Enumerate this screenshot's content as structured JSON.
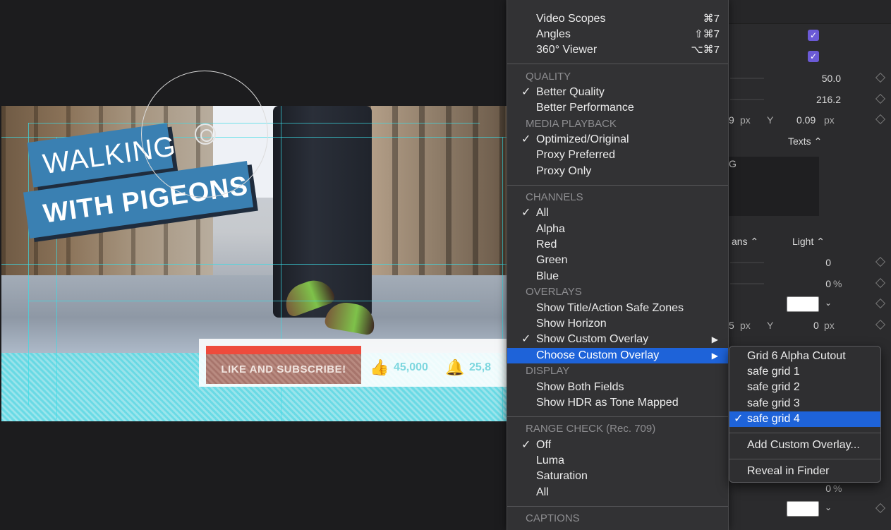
{
  "viewer": {
    "title_line1": "WALKING",
    "title_line2": "WITH PIGEONS",
    "subscribe_text": "LIKE AND SUBSCRIBE!",
    "likes_count": "45,000",
    "notify_count": "25,8"
  },
  "menu": {
    "items_top": [
      {
        "label": "Video Scopes",
        "shortcut": "⌘7"
      },
      {
        "label": "Angles",
        "shortcut": "⇧⌘7"
      },
      {
        "label": "360° Viewer",
        "shortcut": "⌥⌘7"
      }
    ],
    "quality_header": "QUALITY",
    "quality_items": [
      {
        "label": "Better Quality",
        "check": "✓"
      },
      {
        "label": "Better Performance",
        "check": ""
      }
    ],
    "media_header": "MEDIA PLAYBACK",
    "media_items": [
      {
        "label": "Optimized/Original",
        "check": "✓"
      },
      {
        "label": "Proxy Preferred",
        "check": ""
      },
      {
        "label": "Proxy Only",
        "check": ""
      }
    ],
    "channels_header": "CHANNELS",
    "channels_items": [
      {
        "label": "All",
        "check": "✓"
      },
      {
        "label": "Alpha",
        "check": ""
      },
      {
        "label": "Red",
        "check": ""
      },
      {
        "label": "Green",
        "check": ""
      },
      {
        "label": "Blue",
        "check": ""
      }
    ],
    "overlays_header": "OVERLAYS",
    "overlays_items": [
      {
        "label": "Show Title/Action Safe Zones",
        "check": ""
      },
      {
        "label": "Show Horizon",
        "check": ""
      },
      {
        "label": "Show Custom Overlay",
        "check": "✓",
        "arrow": "▶"
      },
      {
        "label": "Choose Custom Overlay",
        "check": "",
        "arrow": "▶"
      }
    ],
    "display_header": "DISPLAY",
    "display_items": [
      {
        "label": "Show Both Fields",
        "check": ""
      },
      {
        "label": "Show HDR as Tone Mapped",
        "check": ""
      }
    ],
    "range_header": "RANGE CHECK (Rec. 709)",
    "range_items": [
      {
        "label": "Off",
        "check": "✓"
      },
      {
        "label": "Luma",
        "check": ""
      },
      {
        "label": "Saturation",
        "check": ""
      },
      {
        "label": "All",
        "check": ""
      }
    ],
    "captions_header": "CAPTIONS"
  },
  "submenu": {
    "items": [
      {
        "label": "Grid 6 Alpha Cutout",
        "check": ""
      },
      {
        "label": "safe grid 1",
        "check": ""
      },
      {
        "label": "safe grid 2",
        "check": ""
      },
      {
        "label": "safe grid 3",
        "check": ""
      },
      {
        "label": "safe grid 4",
        "check": "✓"
      }
    ],
    "add_overlay": "Add Custom Overlay...",
    "reveal_finder": "Reveal in Finder"
  },
  "inspector": {
    "v_50": "50.0",
    "v_216": "216.2",
    "px_unit": "px",
    "pos_x_frag": "9",
    "y_label": "Y",
    "pos_y": "0.09",
    "texts_label": "Texts ⌃",
    "text_frag": "G",
    "font_frag": "ans ⌃",
    "weight": "Light ⌃",
    "v_0a": "0",
    "v_0b": "0",
    "percent": "%",
    "chev": "⌄",
    "shadow_x_frag": "5",
    "shadow_y": "0",
    "bottom_percent_val": "0",
    "check_mark": "✓"
  },
  "colors": {
    "highlight": "#1e63d9",
    "title_blue": "#3a80b2",
    "checkbox_purple": "#6b5ad6",
    "red_bar": "#ee4b3c"
  }
}
